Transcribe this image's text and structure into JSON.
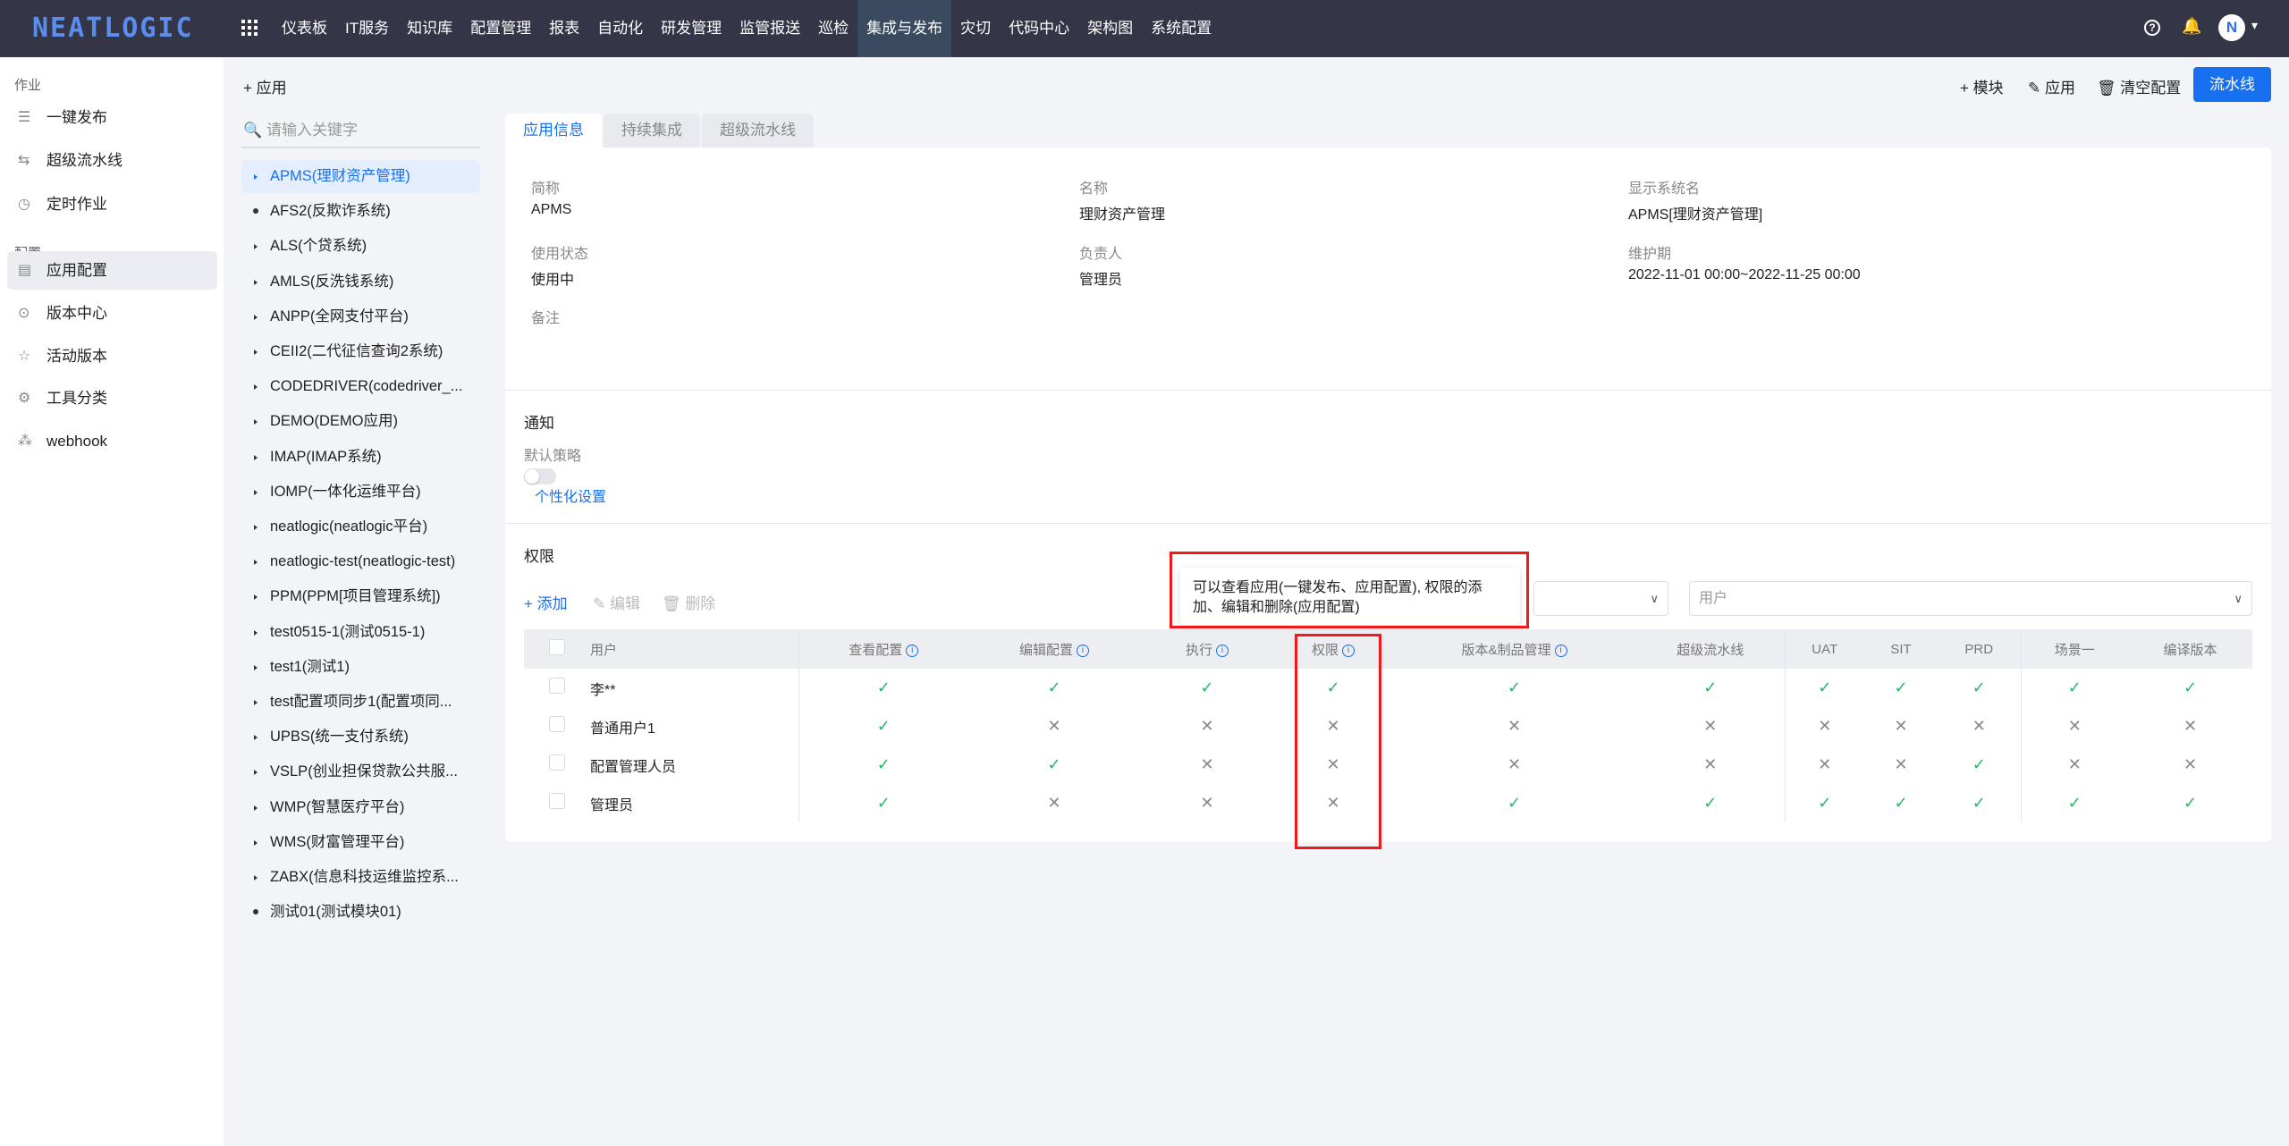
{
  "brand": "NEATLOGIC",
  "nav": [
    "仪表板",
    "IT服务",
    "知识库",
    "配置管理",
    "报表",
    "自动化",
    "研发管理",
    "监管报送",
    "巡检",
    "集成与发布",
    "灾切",
    "代码中心",
    "架构图",
    "系统配置"
  ],
  "nav_active": "集成与发布",
  "sidebar": {
    "groups": [
      "作业",
      "配置"
    ],
    "items": [
      {
        "label": "一键发布",
        "icon": "publish-icon"
      },
      {
        "label": "超级流水线",
        "icon": "pipeline-icon"
      },
      {
        "label": "定时作业",
        "icon": "clock-icon"
      },
      {
        "label": "应用配置",
        "icon": "doc-icon"
      },
      {
        "label": "版本中心",
        "icon": "version-icon"
      },
      {
        "label": "活动版本",
        "icon": "star-icon"
      },
      {
        "label": "工具分类",
        "icon": "gear-icon"
      },
      {
        "label": "webhook",
        "icon": "webhook-icon"
      }
    ]
  },
  "applist": {
    "add_label": "+ 应用",
    "search_placeholder": "请输入关键字",
    "items": [
      "APMS(理财资产管理)",
      "AFS2(反欺诈系统)",
      "ALS(个贷系统)",
      "AMLS(反洗钱系统)",
      "ANPP(全网支付平台)",
      "CEII2(二代征信查询2系统)",
      "CODEDRIVER(codedriver_...",
      "DEMO(DEMO应用)",
      "IMAP(IMAP系统)",
      "IOMP(一体化运维平台)",
      "neatlogic(neatlogic平台)",
      "neatlogic-test(neatlogic-test)",
      "PPM(PPM[项目管理系统])",
      "test0515-1(测试0515-1)",
      "test1(测试1)",
      "test配置项同步1(配置项同...",
      "UPBS(统一支付系统)",
      "VSLP(创业担保贷款公共服...",
      "WMP(智慧医疗平台)",
      "WMS(财富管理平台)",
      "ZABX(信息科技运维监控系...",
      "测试01(测试模块01)"
    ]
  },
  "toolbar": {
    "module": "+ 模块",
    "app": "✎ 应用",
    "clear": "🗑 清空配置",
    "pipeline": "流水线"
  },
  "tabs": [
    "应用信息",
    "持续集成",
    "超级流水线"
  ],
  "info": {
    "abbr_label": "简称",
    "abbr": "APMS",
    "name_label": "名称",
    "name": "理财资产管理",
    "display_label": "显示系统名",
    "display": "APMS[理财资产管理]",
    "status_label": "使用状态",
    "status": "使用中",
    "owner_label": "负责人",
    "owner": "管理员",
    "maint_label": "维护期",
    "maint": "2022-11-01 00:00~2022-11-25 00:00",
    "remark_label": "备注"
  },
  "notify": {
    "title": "通知",
    "policy_label": "默认策略",
    "custom_link": "个性化设置"
  },
  "perm": {
    "title": "权限",
    "add": "+ 添加",
    "edit": "✎ 编辑",
    "delete": "🗑 删除",
    "user_select_placeholder": "用户",
    "tooltip": "可以查看应用(一键发布、应用配置), 权限的添加、编辑和删除(应用配置)",
    "columns": [
      "用户",
      "查看配置",
      "编辑配置",
      "执行",
      "权限",
      "版本&制品管理",
      "超级流水线",
      "UAT",
      "SIT",
      "PRD",
      "场景一",
      "编译版本"
    ],
    "rows": [
      {
        "user": "李**",
        "values": [
          1,
          1,
          1,
          1,
          1,
          1,
          1,
          1,
          1,
          1,
          1
        ]
      },
      {
        "user": "普通用户1",
        "values": [
          1,
          0,
          0,
          0,
          0,
          0,
          0,
          0,
          0,
          0,
          0
        ]
      },
      {
        "user": "配置管理人员",
        "values": [
          1,
          1,
          0,
          0,
          0,
          0,
          0,
          0,
          1,
          0,
          0
        ]
      },
      {
        "user": "管理员",
        "values": [
          1,
          0,
          0,
          0,
          1,
          1,
          1,
          1,
          1,
          1,
          1
        ]
      }
    ]
  },
  "colors": {
    "accent": "#1670f0",
    "check": "#25b864",
    "highlight": "#f01818",
    "topbar": "#343648"
  }
}
